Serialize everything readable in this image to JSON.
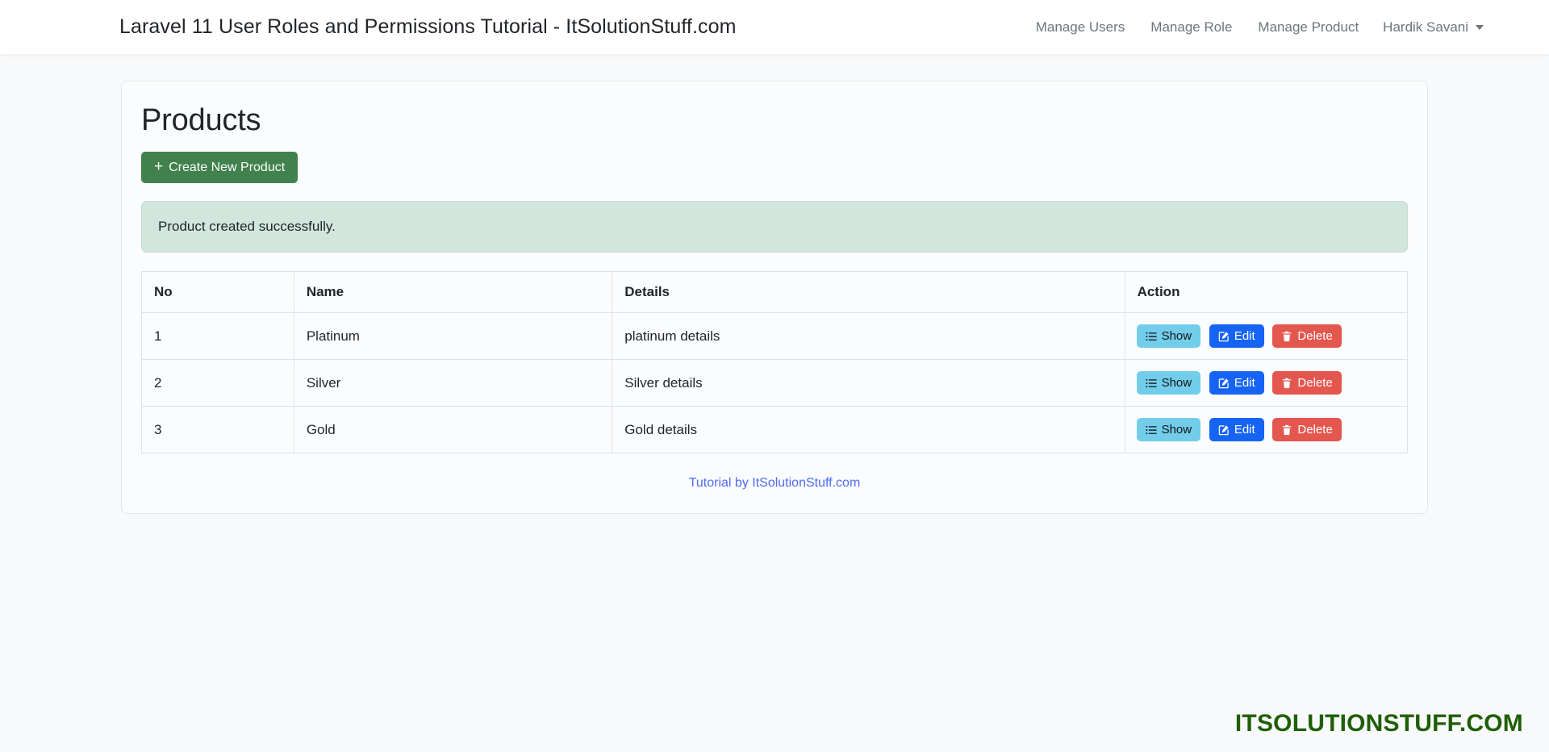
{
  "navbar": {
    "brand": "Laravel 11 User Roles and Permissions Tutorial - ItSolutionStuff.com",
    "links": [
      {
        "label": "Manage Users"
      },
      {
        "label": "Manage Role"
      },
      {
        "label": "Manage Product"
      }
    ],
    "user": {
      "name": "Hardik Savani",
      "caret_icon": "chevron-down-icon"
    }
  },
  "page": {
    "title": "Products",
    "create_button": {
      "label": "Create New Product",
      "icon": "plus-icon",
      "color": "#41814d"
    },
    "alert": {
      "message": "Product created successfully.",
      "background": "#d1e7dd",
      "border": "#c3ddd1"
    }
  },
  "table": {
    "columns": [
      "No",
      "Name",
      "Details",
      "Action"
    ],
    "rows": [
      {
        "no": "1",
        "name": "Platinum",
        "details": "platinum details"
      },
      {
        "no": "2",
        "name": "Silver",
        "details": "Silver details"
      },
      {
        "no": "3",
        "name": "Gold",
        "details": "Gold details"
      }
    ],
    "actions": {
      "show": {
        "label": "Show",
        "icon": "list-icon",
        "color": "#72cdeb"
      },
      "edit": {
        "label": "Edit",
        "icon": "pencil-square-icon",
        "color": "#1564f4"
      },
      "delete": {
        "label": "Delete",
        "icon": "trash-icon",
        "color": "#e4574f"
      }
    }
  },
  "footer": {
    "tutorial_link": "Tutorial by ItSolutionStuff.com",
    "link_color": "#4f6bf6"
  },
  "watermark": {
    "text": "ITSOLUTIONSTUFF.COM",
    "color": "#1f5e06"
  }
}
